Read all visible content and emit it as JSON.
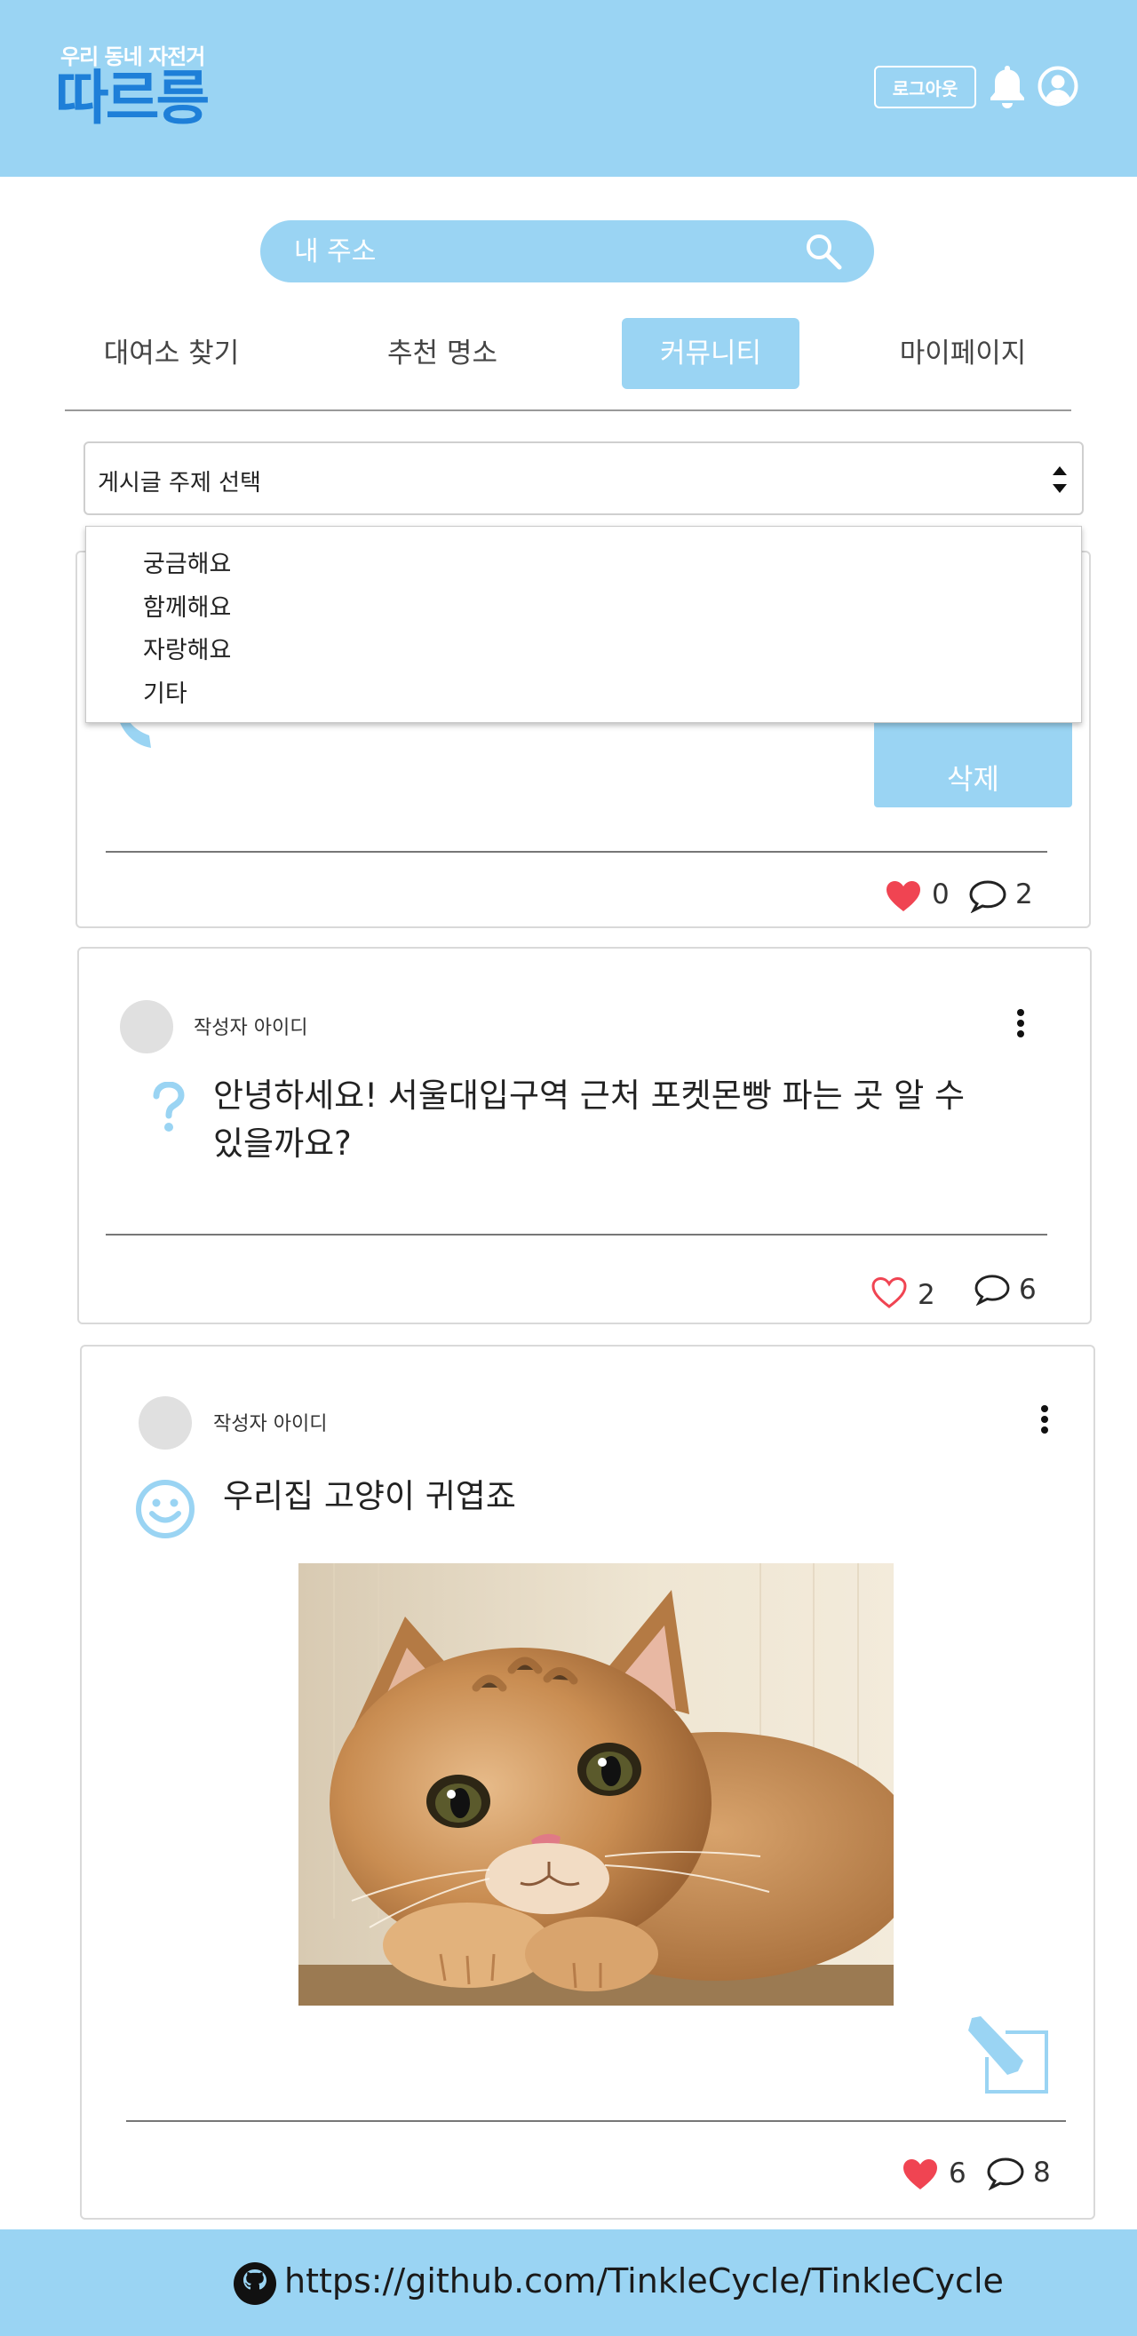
{
  "header": {
    "logo_subtitle": "우리 동네 자전거",
    "logo_title": "따르릉",
    "logout_label": "로그아웃",
    "icons": [
      "bell-icon",
      "user-icon"
    ],
    "background_color": "#9ad4f3",
    "logo_color": "#1e7fd8"
  },
  "search": {
    "placeholder": "내 주소",
    "value": "",
    "icon": "search-icon"
  },
  "tabs": [
    {
      "label": "대여소 찾기",
      "active": false
    },
    {
      "label": "추천 명소",
      "active": false
    },
    {
      "label": "커뮤니티",
      "active": true
    },
    {
      "label": "마이페이지",
      "active": false
    }
  ],
  "topic_select": {
    "label": "게시글 주제 선택",
    "options": [
      "궁금해요",
      "함께해요",
      "자랑해요",
      "기타"
    ]
  },
  "posts": [
    {
      "action_label": "삭제",
      "likes": "0",
      "liked": true,
      "comments": "2"
    },
    {
      "author": "작성자 아이디",
      "category_icon": "question-icon",
      "text_line1": "안녕하세요! 서울대입구역 근처 포켓몬빵 파는 곳 알 수",
      "text_line2": "있을까요?",
      "likes": "2",
      "liked": false,
      "comments": "6"
    },
    {
      "author": "작성자 아이디",
      "category_icon": "smile-icon",
      "text": "우리집 고양이 귀엽죠",
      "image": "cat-photo",
      "edit_icon": "edit-icon",
      "likes": "6",
      "liked": true,
      "comments": "8"
    }
  ],
  "footer": {
    "icon": "github-icon",
    "link_text": "https://github.com/TinkleCycle/TinkleCycle"
  },
  "colors": {
    "accent": "#9ad4f3",
    "heart": "#f04452"
  }
}
